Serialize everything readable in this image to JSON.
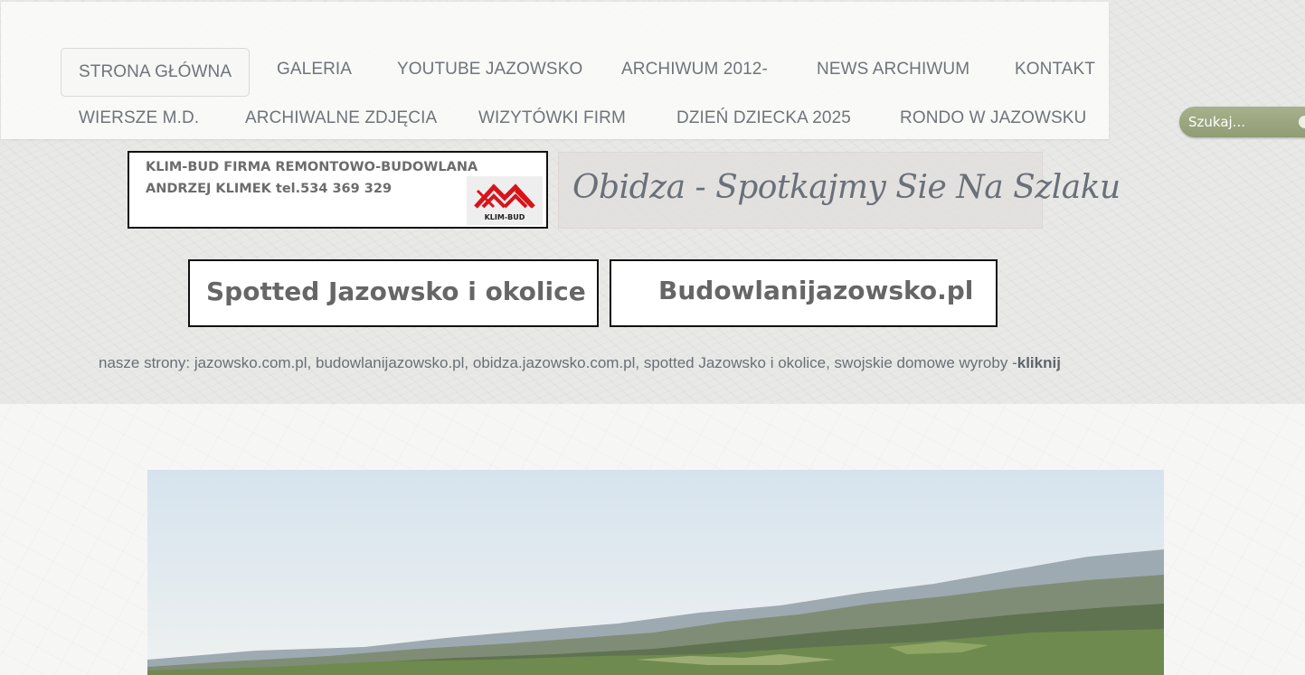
{
  "nav": {
    "row1": [
      {
        "label": "STRONA GŁÓWNA",
        "active": true
      },
      {
        "label": "GALERIA"
      },
      {
        "label": "YOUTUBE JAZOWSKO"
      },
      {
        "label": "ARCHIWUM 2012-"
      },
      {
        "label": "NEWS ARCHIWUM"
      },
      {
        "label": "KONTAKT"
      }
    ],
    "row2": [
      {
        "label": "WIERSZE M.D."
      },
      {
        "label": "ARCHIWALNE ZDJĘCIA"
      },
      {
        "label": "WIZYTÓWKI FIRM"
      },
      {
        "label": "DZIEŃ DZIECKA 2025"
      },
      {
        "label": "RONDO W JAZOWSKU"
      }
    ]
  },
  "search": {
    "placeholder": "Szukaj..."
  },
  "banners": {
    "klim_bud": {
      "line1": "KLIM-BUD FIRMA REMONTOWO-BUDOWLANA",
      "line2": "ANDRZEJ KLIMEK  tel.534 369 329",
      "logo_text": "KLIM-BUD",
      "logo_color": "#d7141a"
    },
    "obidza": "Obidza - Spotkajmy Sie Na Szlaku",
    "spotted": "Spotted Jazowsko i okolice",
    "budowlani": "Budowlanijazowsko.pl"
  },
  "our_sites": {
    "text": "nasze strony: jazowsko.com.pl, budowlanijazowsko.pl, obidza.jazowsko.com.pl, spotted Jazowsko i okolice, swojskie domowe wyroby -",
    "link": "kliknij"
  },
  "colors": {
    "nav_text": "#6f747a",
    "search_bg": "#9aa67f"
  }
}
